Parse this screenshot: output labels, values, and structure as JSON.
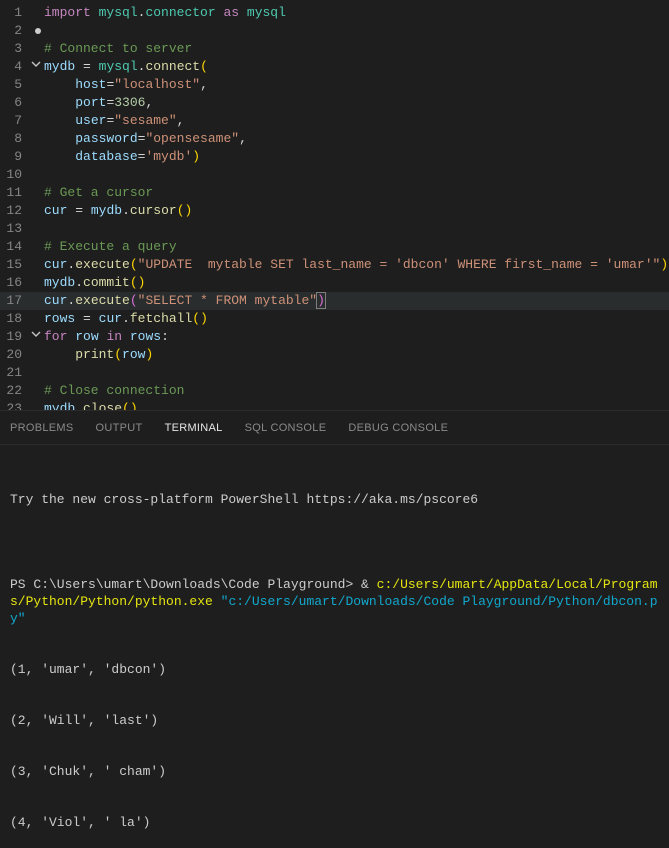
{
  "editor": {
    "lines": [
      {
        "n": "1",
        "fold": "",
        "html": "<span class='kw'>import</span> <span class='mod'>mysql</span><span class='op'>.</span><span class='mod'>connector</span> <span class='kw'>as</span> <span class='mod'>mysql</span>"
      },
      {
        "n": "2",
        "fold": "dot",
        "html": ""
      },
      {
        "n": "3",
        "fold": "",
        "html": "<span class='cmt'># Connect to server</span>"
      },
      {
        "n": "4",
        "fold": "v",
        "html": "<span class='var'>mydb</span> <span class='op'>=</span> <span class='mod'>mysql</span><span class='op'>.</span><span class='fn'>connect</span><span class='br'>(</span>"
      },
      {
        "n": "5",
        "fold": "",
        "html": "    <span class='var'>host</span><span class='op'>=</span><span class='str'>\"localhost\"</span><span class='pn'>,</span>"
      },
      {
        "n": "6",
        "fold": "",
        "html": "    <span class='var'>port</span><span class='op'>=</span><span class='num'>3306</span><span class='pn'>,</span>"
      },
      {
        "n": "7",
        "fold": "",
        "html": "    <span class='var'>user</span><span class='op'>=</span><span class='str'>\"sesame\"</span><span class='pn'>,</span>"
      },
      {
        "n": "8",
        "fold": "",
        "html": "    <span class='var'>password</span><span class='op'>=</span><span class='str'>\"opensesame\"</span><span class='pn'>,</span>"
      },
      {
        "n": "9",
        "fold": "",
        "html": "    <span class='var'>database</span><span class='op'>=</span><span class='str'>'mydb'</span><span class='br'>)</span>"
      },
      {
        "n": "10",
        "fold": "",
        "html": ""
      },
      {
        "n": "11",
        "fold": "",
        "html": "<span class='cmt'># Get a cursor</span>"
      },
      {
        "n": "12",
        "fold": "",
        "html": "<span class='var'>cur</span> <span class='op'>=</span> <span class='var'>mydb</span><span class='op'>.</span><span class='fn'>cursor</span><span class='br'>()</span>"
      },
      {
        "n": "13",
        "fold": "",
        "html": ""
      },
      {
        "n": "14",
        "fold": "",
        "html": "<span class='cmt'># Execute a query</span>"
      },
      {
        "n": "15",
        "fold": "",
        "html": "<span class='var'>cur</span><span class='op'>.</span><span class='fn'>execute</span><span class='br'>(</span><span class='str'>\"UPDATE  mytable SET last_name = 'dbcon' WHERE first_name = 'umar'\"</span><span class='br'>)</span>"
      },
      {
        "n": "16",
        "fold": "",
        "html": "<span class='var'>mydb</span><span class='op'>.</span><span class='fn'>commit</span><span class='br'>()</span>"
      },
      {
        "n": "17",
        "fold": "",
        "html": "<span class='var'>cur</span><span class='op'>.</span><span class='fn'>execute</span><span class='br2'>(</span><span class='str'>\"SELECT * FROM mytable\"</span><span class='br2 sel'>)</span>",
        "hl": true
      },
      {
        "n": "18",
        "fold": "",
        "html": "<span class='var'>rows</span> <span class='op'>=</span> <span class='var'>cur</span><span class='op'>.</span><span class='fn'>fetchall</span><span class='br'>()</span>"
      },
      {
        "n": "19",
        "fold": "v",
        "html": "<span class='kw'>for</span> <span class='var'>row</span> <span class='kw'>in</span> <span class='var'>rows</span><span class='pn'>:</span>"
      },
      {
        "n": "20",
        "fold": "",
        "html": "    <span class='fn'>print</span><span class='br'>(</span><span class='var'>row</span><span class='br'>)</span>"
      },
      {
        "n": "21",
        "fold": "",
        "html": ""
      },
      {
        "n": "22",
        "fold": "",
        "html": "<span class='cmt'># Close connection</span>"
      },
      {
        "n": "23",
        "fold": "",
        "html": "<span class='var'>mydb</span><span class='op'>.</span><span class='fn'>close</span><span class='br'>()</span>"
      }
    ]
  },
  "tabs": {
    "items": [
      {
        "label": "PROBLEMS",
        "active": false
      },
      {
        "label": "OUTPUT",
        "active": false
      },
      {
        "label": "TERMINAL",
        "active": true
      },
      {
        "label": "SQL CONSOLE",
        "active": false
      },
      {
        "label": "DEBUG CONSOLE",
        "active": false
      }
    ]
  },
  "terminal": {
    "line1": "Try the new cross-platform PowerShell https://aka.ms/pscore6",
    "blank": "",
    "promptPrefix": "PS C:\\Users\\umart\\Downloads\\Code Playground> & ",
    "cmdYellow": "c:/Users/umart/AppData/Local/Programs/Python/Python/python.exe ",
    "cmdCyan": "\"c:/Users/umart/Downloads/Code Playground/Python/dbcon.py\"",
    "out1": "(1, 'umar', 'dbcon')",
    "out2": "(2, 'Will', 'last')",
    "out3": "(3, 'Chuk', ' cham')",
    "out4": "(4, 'Viol', ' la')"
  }
}
